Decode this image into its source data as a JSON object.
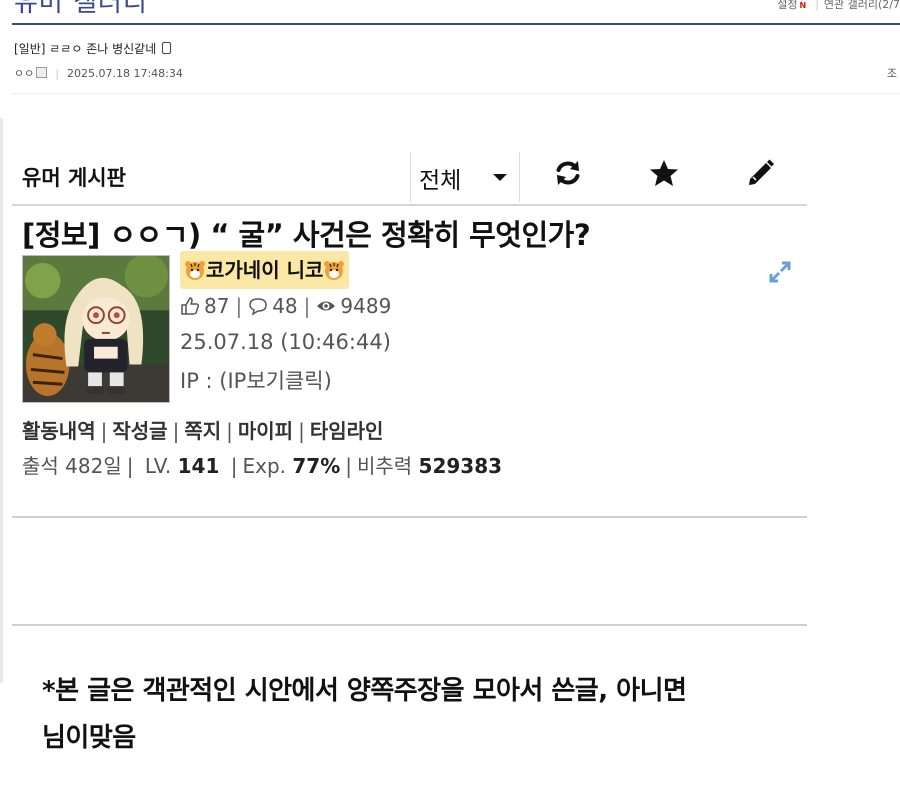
{
  "gallery": {
    "title": "유머 갤러리",
    "top_right_settings": "설정",
    "top_right_new": "N",
    "top_right_related": "연관 갤러리(2/7"
  },
  "post": {
    "title": "[일반] ㄹㄹㅇ 존나 병신같네",
    "author": "ㅇㅇ",
    "datetime": "2025.07.18 17:48:34",
    "views_label": "조"
  },
  "screenshot": {
    "board_name": "유머 게시판",
    "filter_selected": "전체",
    "toolbar": {
      "refresh_icon": "refresh-icon",
      "star_icon": "star-icon",
      "write_icon": "pencil-icon"
    },
    "article_title": "[정보] ㅇㅇㄱ) “ 굴” 사건은 정확히 무엇인가?",
    "nickname": "코가네이 니코",
    "likes": "87",
    "comments": "48",
    "views": "9489",
    "date": "25.07.18 (10:46:44)",
    "ip": "IP : (IP보기클릭)",
    "activity_links": [
      "활동내역",
      "작성글",
      "쪽지",
      "마이피",
      "타임라인"
    ],
    "attendance": "출석 482일",
    "level_label": "LV.",
    "level_value": "141",
    "exp_label": "Exp.",
    "exp_value": "77%",
    "recommend_label": "비추력",
    "recommend_value": "529383",
    "body_line1": "*본 글은 객관적인 시안에서 양쪽주장을 모아서 쓴글, 아니면",
    "body_line2": "님이맞음"
  },
  "colors": {
    "gallery_accent": "#3b4890",
    "nickname_badge": "#fbe7a6",
    "expand_icon": "#6a9fd6"
  }
}
